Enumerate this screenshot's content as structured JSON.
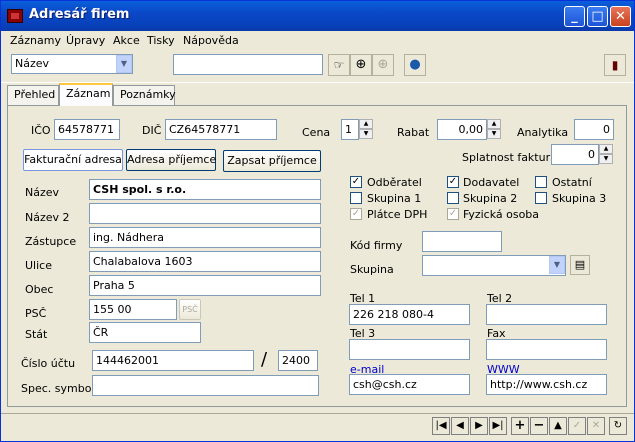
{
  "window": {
    "title": "Adresář firem"
  },
  "menu": [
    "Záznamy",
    "Úpravy",
    "Akce",
    "Tisky",
    "Nápověda"
  ],
  "toolbar": {
    "sort_select": "Název",
    "search_value": ""
  },
  "tabs": [
    "Přehled",
    "Záznam",
    "Poznámky"
  ],
  "form": {
    "ico_label": "IČO",
    "ico": "64578771",
    "dic_label": "DIČ",
    "dic": "CZ64578771",
    "cena_label": "Cena",
    "cena": "1",
    "rabat_label": "Rabat",
    "rabat": "0,00",
    "analytika_label": "Analytika",
    "analytika": "0",
    "splatnost_label": "Splatnost faktur",
    "splatnost": "0",
    "btn_fakturacni": "Fakturační adresa",
    "btn_prijemce": "Adresa příjemce",
    "btn_zapsat": "Zapsat příjemce",
    "nazev_label": "Název",
    "nazev": "CSH spol. s r.o.",
    "nazev2_label": "Název 2",
    "nazev2": "",
    "zastupce_label": "Zástupce",
    "zastupce": "ing. Nádhera",
    "ulice_label": "Ulice",
    "ulice": "Chalabalova 1603",
    "obec_label": "Obec",
    "obec": "Praha 5",
    "psc_label": "PSČ",
    "psc": "155 00",
    "psc_btn": "PSČ",
    "stat_label": "Stát",
    "stat": "ČR",
    "cislo_uctu_label": "Číslo účtu",
    "cislo_uctu": "144462001",
    "slash": "/",
    "kod_banky": "2400",
    "spec_symbol_label": "Spec. symbol",
    "spec_symbol": "",
    "checks": {
      "odberatel": "Odběratel",
      "dodavatel": "Dodavatel",
      "ostatni": "Ostatní",
      "skupina1": "Skupina 1",
      "skupina2": "Skupina 2",
      "skupina3": "Skupina 3",
      "platce_dph": "Plátce DPH",
      "fyzicka_osoba": "Fyzická osoba"
    },
    "kod_firmy_label": "Kód firmy",
    "kod_firmy": "",
    "skupina_label": "Skupina",
    "skupina": "",
    "tel1_label": "Tel 1",
    "tel1": "226 218 080-4",
    "tel2_label": "Tel 2",
    "tel2": "",
    "tel3_label": "Tel 3",
    "tel3": "",
    "fax_label": "Fax",
    "fax": "",
    "email_label": "e-mail",
    "email": "csh@csh.cz",
    "www_label": "WWW",
    "www": "http://www.csh.cz"
  }
}
